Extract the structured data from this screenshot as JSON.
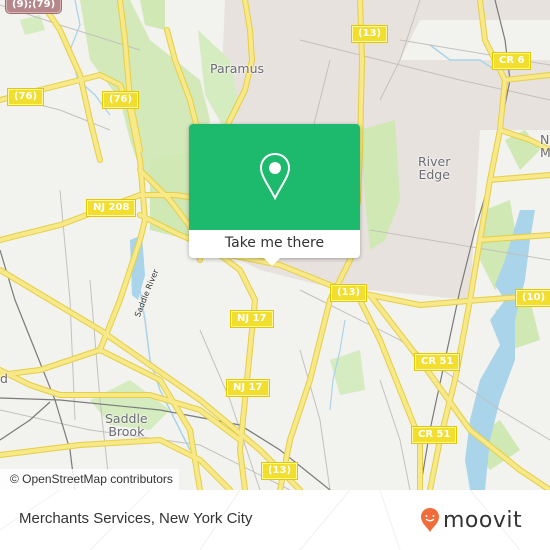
{
  "map": {
    "colors": {
      "background": "#f2f2ef",
      "residential": "#e8e2df",
      "park": "#cfe8b4",
      "water": "#a9d4ea",
      "road_major": "#f4e27a",
      "road_casing": "#e6cf43",
      "road_minor": "#bdbdbd",
      "rail": "#777777"
    },
    "road_shields": [
      {
        "label": "(9);(79)",
        "style": "red"
      },
      {
        "label": "(76)",
        "style": "yellow"
      },
      {
        "label": "(76)",
        "style": "yellow"
      },
      {
        "label": "(13)",
        "style": "yellow"
      },
      {
        "label": "CR 6",
        "style": "yellow"
      },
      {
        "label": "NJ 208",
        "style": "yellow"
      },
      {
        "label": "(13)",
        "style": "yellow"
      },
      {
        "label": "NJ 17",
        "style": "yellow"
      },
      {
        "label": "NJ 17",
        "style": "yellow"
      },
      {
        "label": "(10)",
        "style": "yellow"
      },
      {
        "label": "CR 51",
        "style": "yellow"
      },
      {
        "label": "CR 51",
        "style": "yellow"
      },
      {
        "label": "(13)",
        "style": "yellow"
      }
    ],
    "places": {
      "paramus": "Paramus",
      "river_edge_1": "River",
      "river_edge_2": "Edge",
      "new_milford_1": "N",
      "new_milford_2": "Mi",
      "saddle_brook_1": "Saddle",
      "saddle_brook_2": "Brook",
      "lodi_partial": "d",
      "saddle_river": "Saddle River"
    },
    "attribution": "© OpenStreetMap contributors"
  },
  "popup": {
    "icon": "map-pin-icon",
    "button_label": "Take me there",
    "color": "#1db96d"
  },
  "footer": {
    "title": "Merchants Services, New York City",
    "logo_text": "moovit",
    "logo_color": "#f26b3a"
  }
}
